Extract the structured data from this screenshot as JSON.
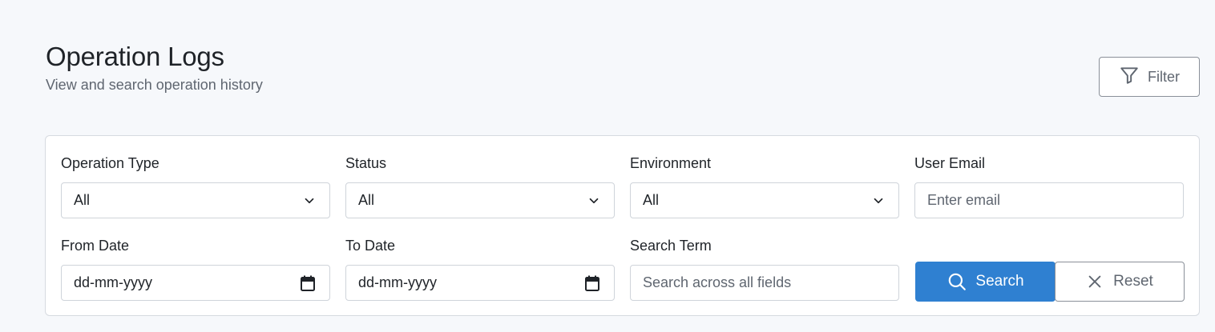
{
  "header": {
    "title": "Operation Logs",
    "subtitle": "View and search operation history",
    "filter_label": "Filter"
  },
  "filters": {
    "operation_type": {
      "label": "Operation Type",
      "value": "All"
    },
    "status": {
      "label": "Status",
      "value": "All"
    },
    "environment": {
      "label": "Environment",
      "value": "All"
    },
    "user_email": {
      "label": "User Email",
      "placeholder": "Enter email"
    },
    "from_date": {
      "label": "From Date",
      "placeholder": "dd-mm-yyyy"
    },
    "to_date": {
      "label": "To Date",
      "placeholder": "dd-mm-yyyy"
    },
    "search_term": {
      "label": "Search Term",
      "placeholder": "Search across all fields"
    }
  },
  "actions": {
    "search_label": "Search",
    "reset_label": "Reset"
  },
  "colors": {
    "primary": "#2f80d1",
    "background": "#f6f8fb",
    "border": "#cfd4da"
  }
}
